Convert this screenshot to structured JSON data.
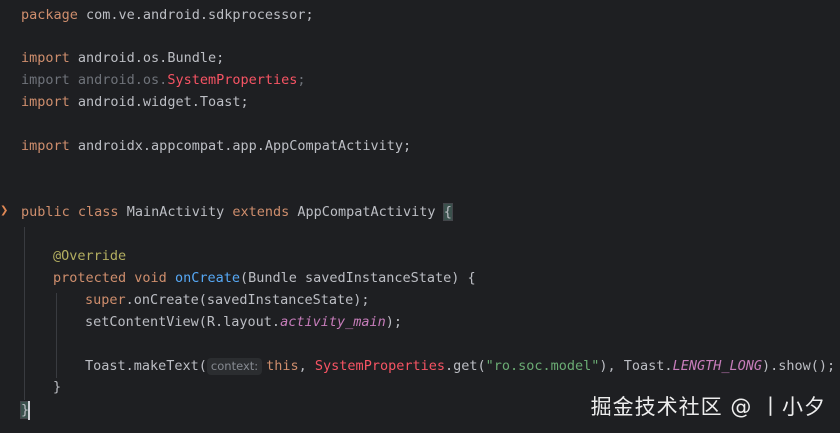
{
  "code": {
    "package_kw": "package",
    "package_name": " com.ve.android.sdkprocessor;",
    "import_kw": "import",
    "import_bundle": " android.os.Bundle;",
    "import_sysprop_prefix": " android.os.",
    "import_sysprop_class": "SystemProperties",
    "import_sysprop_end": ";",
    "import_toast": " android.widget.Toast;",
    "import_appcompat": " androidx.appcompat.app.AppCompatActivity;",
    "class_public": "public",
    "class_kw": "class",
    "class_name": " MainActivity ",
    "class_extends": "extends",
    "class_parent": " AppCompatActivity ",
    "open_brace": "{",
    "annotation": "@Override",
    "method_protected": "protected",
    "method_void": "void",
    "method_name": "onCreate",
    "method_params": "(Bundle savedInstanceState) {",
    "super_kw": "super",
    "super_call": ".onCreate(savedInstanceState);",
    "set_content_prefix": "setContentView(R.layout.",
    "set_content_const": "activity_main",
    "set_content_end": ");",
    "toast_prefix": "Toast.makeText(",
    "param_hint": "context:",
    "this_kw": "this",
    "comma_space": ", ",
    "sysprop_class": "SystemProperties",
    "get_call": ".get(",
    "string_literal": "\"ro.soc.model\"",
    "toast_middle": "), Toast.",
    "length_const": "LENGTH_LONG",
    "toast_end": ").show();",
    "method_close": "}",
    "class_close": "}"
  },
  "watermark": "掘金技术社区 @ 丨小夕",
  "colors": {
    "background": "#1e1f22",
    "keyword": "#cf8e6d",
    "function": "#56a8f5",
    "string": "#6aab73",
    "constant": "#c77dbb",
    "annotation": "#b3ae60",
    "error": "#f75464"
  }
}
